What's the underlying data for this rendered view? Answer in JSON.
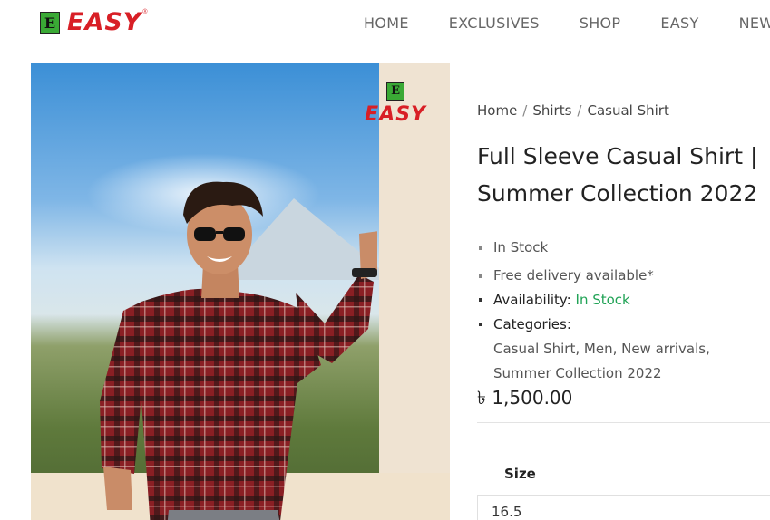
{
  "header": {
    "logo_badge_letter": "E",
    "logo_text": "EASY",
    "logo_reg": "®",
    "nav": [
      "HOME",
      "EXCLUSIVES",
      "SHOP",
      "EASY",
      "NEWS"
    ]
  },
  "product_image": {
    "logo_badge_letter": "E",
    "logo_text": "EASY"
  },
  "breadcrumb": {
    "items": [
      "Home",
      "Shirts",
      "Casual Shirt"
    ],
    "separator": "/"
  },
  "product": {
    "title": "Full Sleeve Casual Shirt | Summer Collection 2022",
    "features": [
      "In Stock",
      "Free delivery available*"
    ],
    "availability_label": "Availability:",
    "availability_value": "In Stock",
    "categories_label": "Categories:",
    "categories_line1": "Casual Shirt, Men, New arrivals,",
    "categories_line2": "Summer Collection 2022",
    "price": "৳ 1,500.00",
    "size_label": "Size",
    "size_value": "16.5"
  },
  "colors": {
    "brand_red": "#d81f26",
    "brand_green": "#3aa935",
    "stock_green": "#21a356"
  }
}
